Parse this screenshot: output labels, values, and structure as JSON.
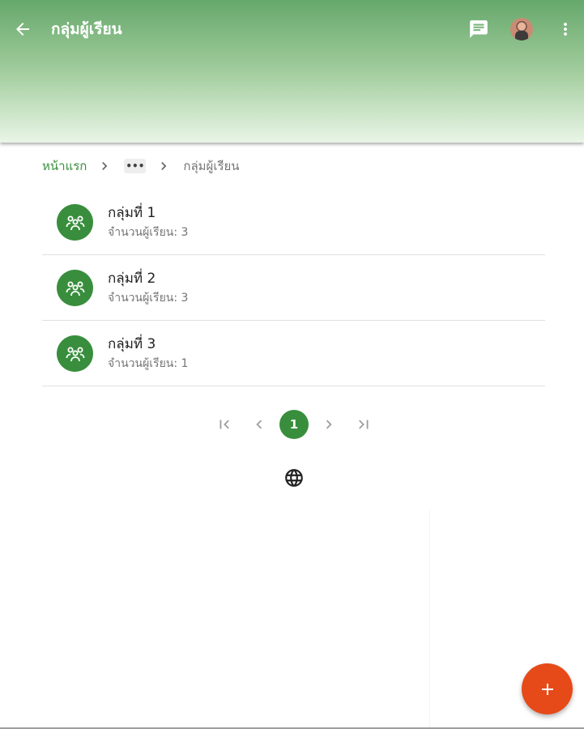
{
  "appbar": {
    "title": "กลุ่มผู้เรียน",
    "back_icon": "arrow-back-icon",
    "chat_icon": "chat-icon",
    "more_icon": "more-vert-icon",
    "gradient_top": "#66a86c",
    "gradient_bottom": "#e9f5e6"
  },
  "breadcrumb": {
    "home": "หน้าแรก",
    "ellipsis": "•••",
    "current": "กลุ่มผู้เรียน"
  },
  "groups": [
    {
      "title": "กลุ่มที่ 1",
      "subtitle": "จำนวนผู้เรียน: 3"
    },
    {
      "title": "กลุ่มที่ 2",
      "subtitle": "จำนวนผู้เรียน: 3"
    },
    {
      "title": "กลุ่มที่ 3",
      "subtitle": "จำนวนผู้เรียน: 1"
    }
  ],
  "pagination": {
    "current_page": "1"
  },
  "colors": {
    "primary": "#388e3c",
    "accent": "#e64a19"
  }
}
